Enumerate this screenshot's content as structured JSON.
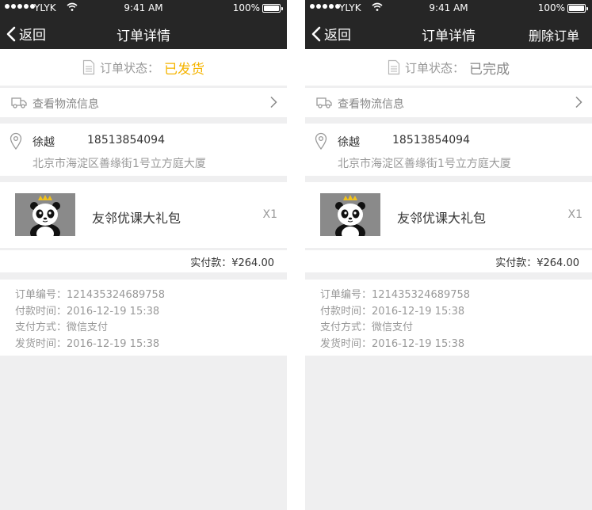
{
  "status_bar": {
    "carrier": "YLYK",
    "time": "9:41 AM",
    "battery": "100%"
  },
  "screens": [
    {
      "nav": {
        "back": "返回",
        "title": "订单详情",
        "action": ""
      },
      "order_status": {
        "label": "订单状态：",
        "value": "已发货"
      },
      "logistics": {
        "label": "查看物流信息"
      },
      "address": {
        "name": "徐越",
        "phone": "18513854094",
        "address": "北京市海淀区善缘街1号立方庭大厦"
      },
      "product": {
        "name": "友邻优课大礼包",
        "quantity": "X1"
      },
      "payment": {
        "label": "实付款：",
        "amount": "¥264.00"
      },
      "info": {
        "order_no": "订单编号：121435324689758",
        "pay_time": "付款时间：2016-12-19  15:38",
        "pay_method": "支付方式：微信支付",
        "ship_time": "发货时间：2016-12-19  15:38"
      }
    },
    {
      "nav": {
        "back": "返回",
        "title": "订单详情",
        "action": "删除订单"
      },
      "order_status": {
        "label": "订单状态：",
        "value": "已完成"
      },
      "logistics": {
        "label": "查看物流信息"
      },
      "address": {
        "name": "徐越",
        "phone": "18513854094",
        "address": "北京市海淀区善缘街1号立方庭大厦"
      },
      "product": {
        "name": "友邻优课大礼包",
        "quantity": "X1"
      },
      "payment": {
        "label": "实付款：",
        "amount": "¥264.00"
      },
      "info": {
        "order_no": "订单编号：121435324689758",
        "pay_time": "付款时间：2016-12-19  15:38",
        "pay_method": "支付方式：微信支付",
        "ship_time": "发货时间：2016-12-19  15:38"
      }
    }
  ],
  "icons": [
    "signal-dots-icon",
    "wifi-icon",
    "battery-icon",
    "back-chevron-icon",
    "document-icon",
    "truck-icon",
    "chevron-right-icon",
    "location-pin-icon",
    "panda-thumbnail"
  ],
  "colors": {
    "navbar": "#262626",
    "background": "#efeff0",
    "shipped_status": "#f5b400",
    "completed_status": "#888888",
    "muted_text": "#999999"
  }
}
